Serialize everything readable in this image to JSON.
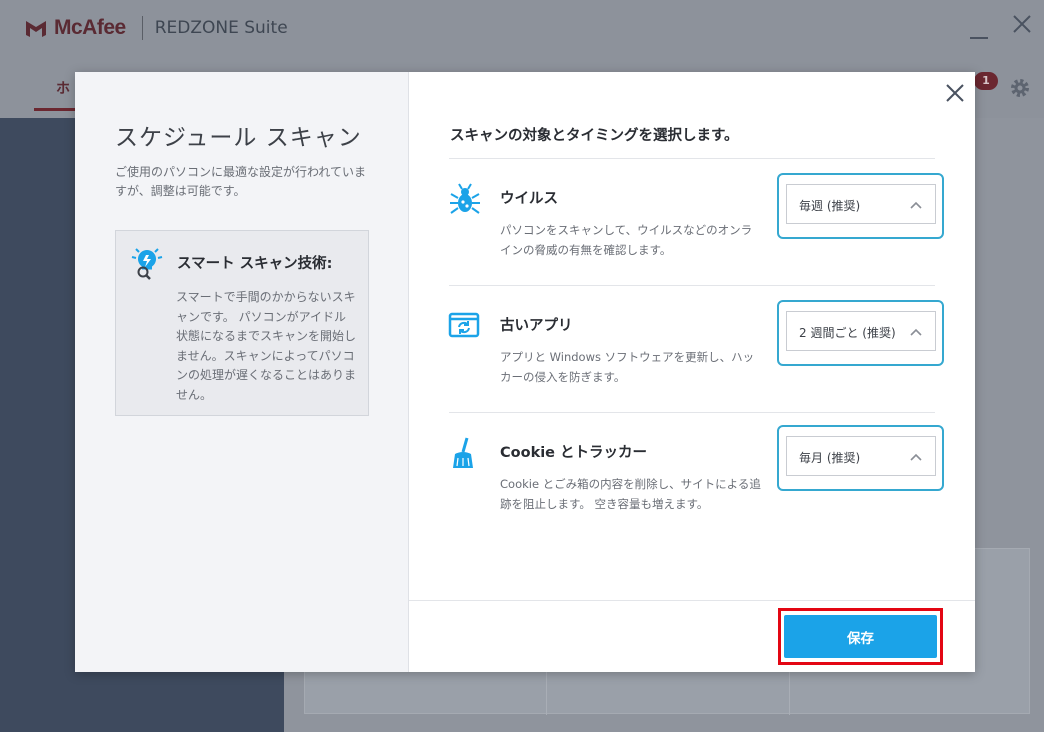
{
  "app": {
    "brand": "McAfee",
    "suite": "REDZONE Suite",
    "tab_home": "ホ",
    "notification_count": "1"
  },
  "modal": {
    "title": "スケジュール スキャン",
    "description": "ご使用のパソコンに最適な設定が行われていますが、調整は可能です。",
    "smart": {
      "title": "スマート スキャン技術:",
      "description": "スマートで手間のかからないスキャンです。 パソコンがアイドル状態になるまでスキャンを開始しません。スキャンによってパソコンの処理が遅くなることはありません。"
    },
    "heading": "スキャンの対象とタイミングを選択します。",
    "rows": [
      {
        "icon": "virus-bug-icon",
        "title": "ウイルス",
        "description": "パソコンをスキャンして、ウイルスなどのオンラインの脅威の有無を確認します。",
        "selected": "毎週 (推奨)"
      },
      {
        "icon": "app-refresh-icon",
        "title": "古いアプリ",
        "description": "アプリと Windows ソフトウェアを更新し、ハッカーの侵入を防ぎます。",
        "selected": "2 週間ごと (推奨)"
      },
      {
        "icon": "broom-icon",
        "title": "Cookie とトラッカー",
        "description": "Cookie とごみ箱の内容を削除し、サイトによる追跡を阻止します。 空き容量も増えます。",
        "selected": "毎月 (推奨)"
      }
    ],
    "save_label": "保存"
  },
  "colors": {
    "accent": "#1ba3e8",
    "select_border": "#35a8d0",
    "highlight": "#e30613",
    "brand": "#6b2730"
  }
}
